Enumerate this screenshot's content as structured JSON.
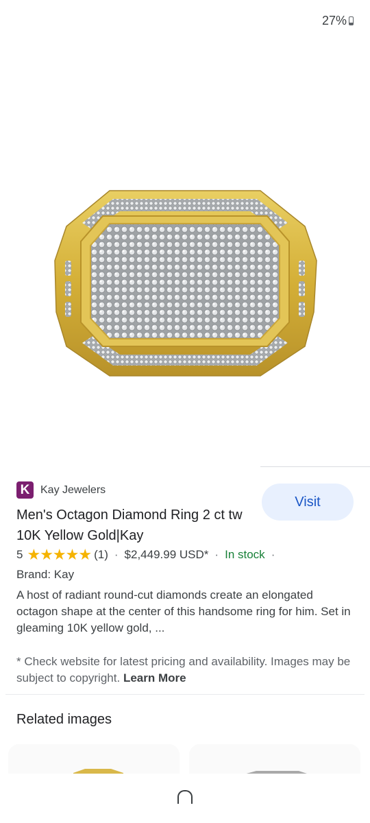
{
  "status": {
    "battery": "27%"
  },
  "product": {
    "source_name": "Kay Jewelers",
    "source_logo_letter": "K",
    "visit_label": "Visit",
    "title": "Men's Octagon Diamond Ring 2 ct tw 10K Yellow Gold|Kay",
    "rating_value": "5",
    "stars": "★★★★★",
    "review_count": "(1)",
    "separator": "·",
    "price": "$2,449.99 USD*",
    "stock": "In stock",
    "brand": "Brand: Kay",
    "description": "A host of radiant round-cut diamonds create an elongated octagon shape at the center of this handsome ring for him. Set in gleaming 10K yellow gold, ..."
  },
  "disclaimer": {
    "text": "* Check website for latest pricing and availability. Images may be subject to copyright.",
    "learn_more": "Learn More"
  },
  "related": {
    "title": "Related images"
  },
  "colors": {
    "visit_bg": "#e8f0fe",
    "visit_text": "#1a56c6",
    "in_stock": "#188038",
    "stars": "#f5b301",
    "kay_brand": "#7b1e6f",
    "gold": "#d4af37"
  },
  "icons": {
    "battery": "battery-icon",
    "home": "home-button-icon"
  }
}
